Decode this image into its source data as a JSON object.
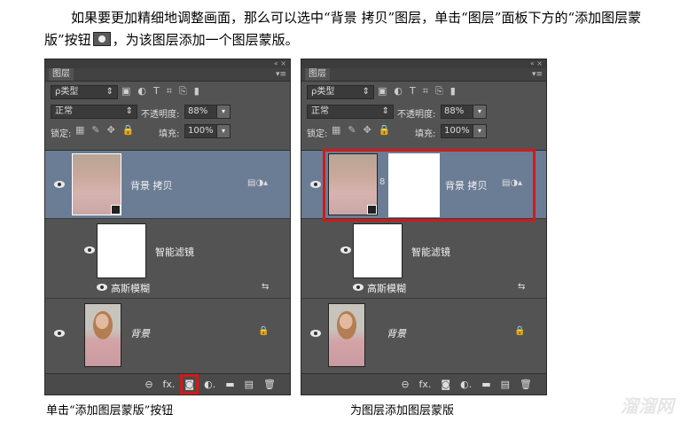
{
  "intro": {
    "text_before": "如果要更加精细地调整画面，那么可以选中“背景 拷贝”图层，单击“图层”面板下方的“添加图层蒙版”按钮",
    "text_after": "，为该图层添加一个图层蒙版。"
  },
  "panels": [
    {
      "window_controls": "« ×",
      "tab_label": "图层",
      "tab_menu": "▾≡",
      "filter_label": "ρ类型",
      "filter_chevron": "⇕",
      "filter_icons": [
        "▣",
        "◐",
        "T",
        "⌗",
        "⎘",
        "▮"
      ],
      "blend_mode": "正常",
      "blend_chevron": "⇕",
      "opacity_label": "不透明度:",
      "opacity_value": "88%",
      "dropdown_arrow": "▾",
      "lock_label": "锁定:",
      "lock_icons": [
        "▦",
        "✎",
        "✥",
        "🔒"
      ],
      "fill_label": "填充:",
      "fill_value": "100%",
      "layer_copy": "背景 拷贝",
      "smart_filters": "智能滤镜",
      "gaussian_blur": "高斯模糊",
      "background": "背景",
      "lock_glyph": "🔒",
      "bottom_icons": [
        "⊖",
        "fx.",
        "◙",
        "◐.",
        "▬",
        "▤",
        "🗑"
      ]
    },
    {
      "window_controls": "« ×",
      "tab_label": "图层",
      "tab_menu": "▾≡",
      "filter_label": "ρ类型",
      "filter_chevron": "⇕",
      "filter_icons": [
        "▣",
        "◐",
        "T",
        "⌗",
        "⎘",
        "▮"
      ],
      "blend_mode": "正常",
      "blend_chevron": "⇕",
      "opacity_label": "不透明度:",
      "opacity_value": "88%",
      "dropdown_arrow": "▾",
      "lock_label": "锁定:",
      "lock_icons": [
        "▦",
        "✎",
        "✥",
        "🔒"
      ],
      "fill_label": "填充:",
      "fill_value": "100%",
      "layer_copy": "背景 拷贝",
      "smart_filters": "智能滤镜",
      "gaussian_blur": "高斯模糊",
      "background": "背景",
      "lock_glyph": "🔒",
      "chain_glyph": "8",
      "bottom_icons": [
        "⊖",
        "fx.",
        "◙",
        "◐.",
        "▬",
        "▤",
        "🗑"
      ]
    }
  ],
  "captions": {
    "left": "单击“添加图层蒙版”按钮",
    "right": "为图层添加图层蒙版"
  },
  "watermark": "溜溜网"
}
